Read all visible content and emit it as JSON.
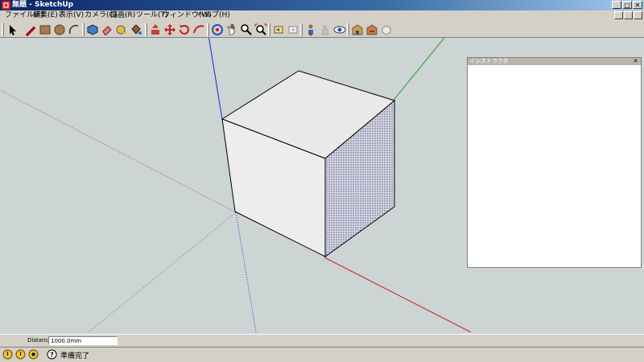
{
  "window": {
    "title": "無題 - SketchUp",
    "min": "_",
    "max": "□",
    "close": "✕"
  },
  "menu": [
    "ファイル(F)",
    "編集(E)",
    "表示(V)",
    "カメラ(C)",
    "描画(R)",
    "ツール(T)",
    "ウィンドウ(W)",
    "ヘルプ(H)"
  ],
  "toolbar_icons": [
    "select-arrow-icon",
    "pencil-line-icon",
    "rectangle-icon",
    "circle-icon",
    "arc-icon",
    "make-component-icon",
    "eraser-icon",
    "tape-measure-icon",
    "paint-bucket-icon",
    "push-pull-icon",
    "move-icon",
    "rotate-icon",
    "follow-me-icon",
    "orbit-icon",
    "pan-icon",
    "zoom-icon",
    "zoom-extents-icon",
    "previous-view-icon",
    "next-view-icon",
    "position-camera-icon",
    "walk-icon",
    "look-around-icon",
    "3d-warehouse-icon",
    "share-model-icon",
    "get-components-icon"
  ],
  "instructor": {
    "title": "インストラクタ",
    "close": "✕"
  },
  "vcb": {
    "label": "Distance",
    "value": "1000.0mm"
  },
  "status": {
    "text": "準備完了"
  },
  "colors": {
    "viewport_bg": "#ccd4d4",
    "chrome": "#d4d0c8",
    "title_from": "#0a246a",
    "title_to": "#a6caf0",
    "axis_red": "#d02020",
    "axis_green": "#20a020",
    "axis_blue": "#2020d0"
  }
}
